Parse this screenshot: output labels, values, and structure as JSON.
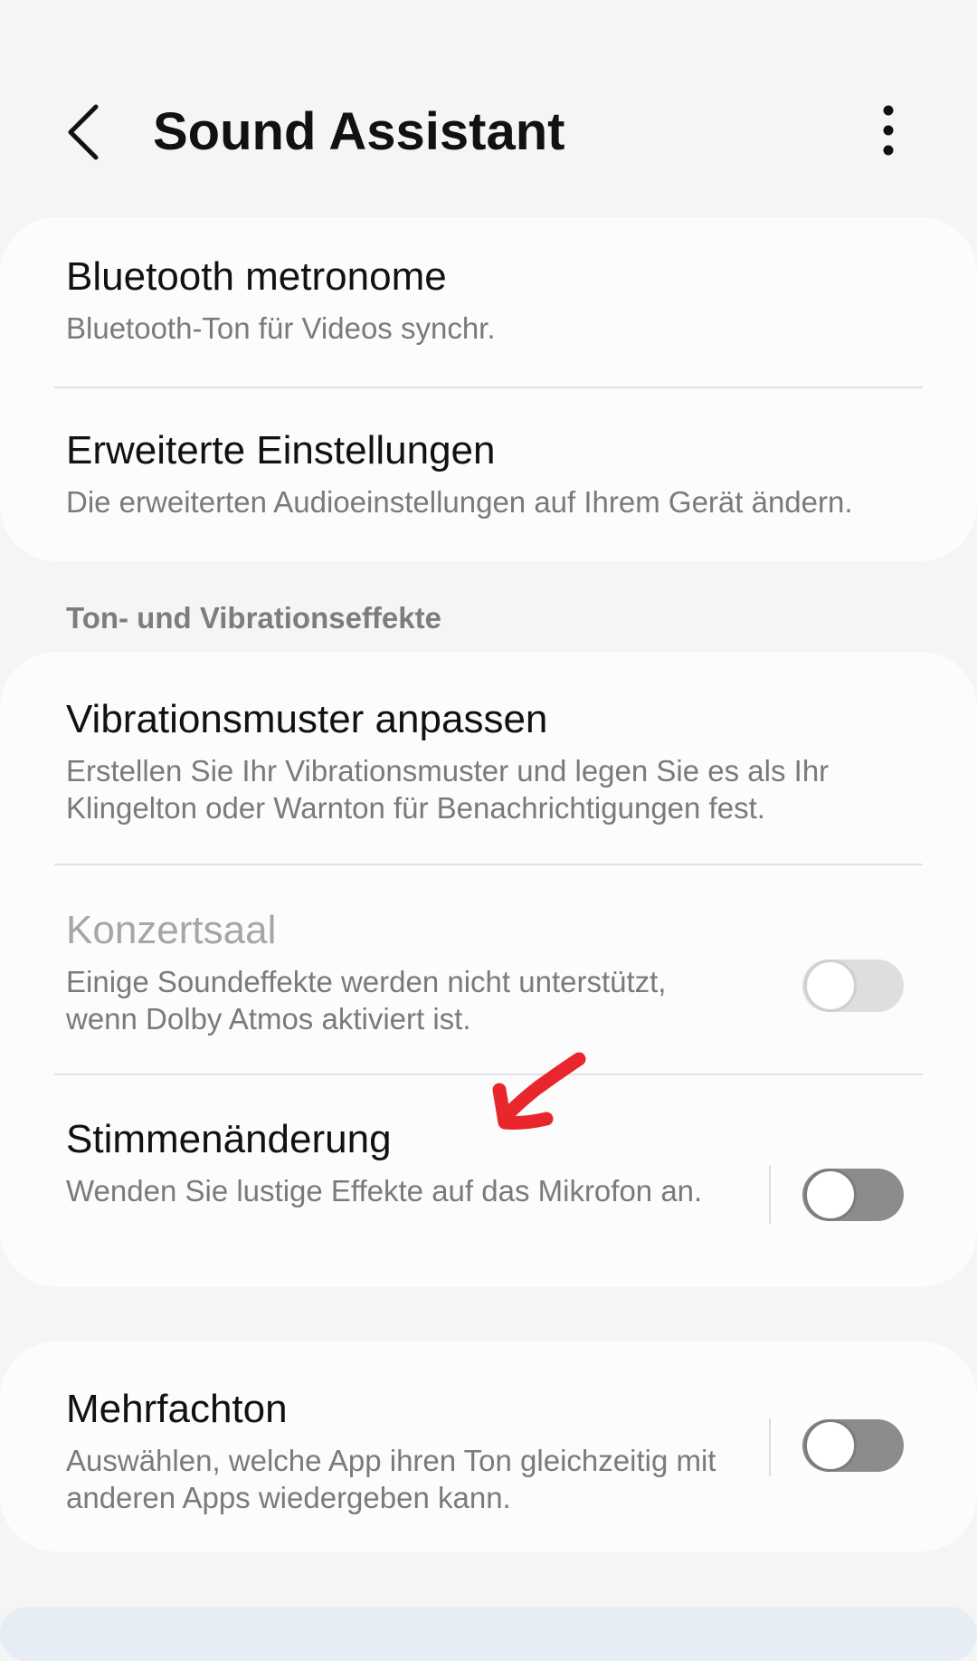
{
  "header": {
    "title": "Sound Assistant",
    "back_icon": "chevron-left-icon",
    "more_icon": "more-vertical-icon"
  },
  "items_group1": [
    {
      "title": "Bluetooth metronome",
      "subtitle": "Bluetooth-Ton für Videos synchr."
    },
    {
      "title": "Erweiterte Einstellungen",
      "subtitle": "Die erweiterten Audioeinstellungen auf Ihrem Gerät ändern."
    }
  ],
  "section": {
    "label": "Ton- und Vibrationseffekte"
  },
  "items_group2": [
    {
      "title": "Vibrationsmuster anpassen",
      "subtitle": "Erstellen Sie Ihr Vibrationsmuster und legen Sie es als Ihr Klingelton oder Warnton für Benachrichtigungen fest."
    },
    {
      "title": "Konzertsaal",
      "subtitle": "Einige Soundeffekte werden nicht unterstützt, wenn Dolby Atmos aktiviert ist.",
      "toggle": "off",
      "enabled": false
    },
    {
      "title": "Stimmenänderung",
      "subtitle": "Wenden Sie lustige Effekte auf das Mikrofon an.",
      "toggle": "off",
      "enabled": true
    }
  ],
  "items_group3": [
    {
      "title": "Mehrfachton",
      "subtitle": "Auswählen, welche App ihren Ton gleichzeitig mit anderen Apps wiedergeben kann.",
      "toggle": "off",
      "enabled": true
    }
  ],
  "colors": {
    "background": "#f5f5f5",
    "card": "#fcfcfc",
    "toggle_off": "#8c8c8c",
    "toggle_disabled": "#dedede",
    "annotation_arrow": "#e8262b"
  }
}
